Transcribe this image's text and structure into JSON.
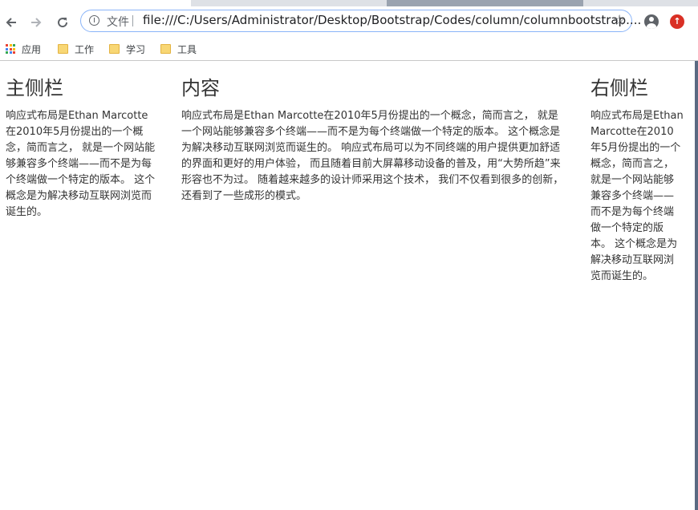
{
  "browser": {
    "omnibox_label": "文件",
    "url": "file:///C:/Users/Administrator/Desktop/Bootstrap/Codes/column/columnbootstrap....",
    "icons": {
      "back": "arrow-left-icon",
      "forward": "arrow-right-icon",
      "reload": "reload-icon",
      "info": "info-icon",
      "star": "star-icon",
      "account": "account-icon",
      "update": "update-icon"
    }
  },
  "bookmarks": [
    {
      "label": "应用",
      "icon": "apps-grid-icon"
    },
    {
      "label": "工作",
      "icon": "folder-icon"
    },
    {
      "label": "学习",
      "icon": "folder-icon"
    },
    {
      "label": "工具",
      "icon": "folder-icon"
    }
  ],
  "columns": {
    "left": {
      "heading": "主侧栏",
      "text": "响应式布局是Ethan Marcotte在2010年5月份提出的一个概念，简而言之， 就是一个网站能够兼容多个终端——而不是为每个终端做一个特定的版本。 这个概念是为解决移动互联网浏览而诞生的。"
    },
    "main": {
      "heading": "内容",
      "text": "响应式布局是Ethan Marcotte在2010年5月份提出的一个概念，简而言之， 就是一个网站能够兼容多个终端——而不是为每个终端做一个特定的版本。 这个概念是为解决移动互联网浏览而诞生的。 响应式布局可以为不同终端的用户提供更加舒适的界面和更好的用户体验， 而且随着目前大屏幕移动设备的普及，用“大势所趋”来形容也不为过。 随着越来越多的设计师采用这个技术， 我们不仅看到很多的创新， 还看到了一些成形的模式。"
    },
    "right": {
      "heading": "右侧栏",
      "text": "响应式布局是Ethan Marcotte在2010年5月份提出的一个概念，简而言之， 就是一个网站能够兼容多个终端——而不是为每个终端做一个特定的版本。 这个概念是为解决移动互联网浏览而诞生的。"
    }
  },
  "colors": {
    "accent_focus": "#8ab4f8",
    "update_badge": "#d93025",
    "text": "#333333"
  }
}
